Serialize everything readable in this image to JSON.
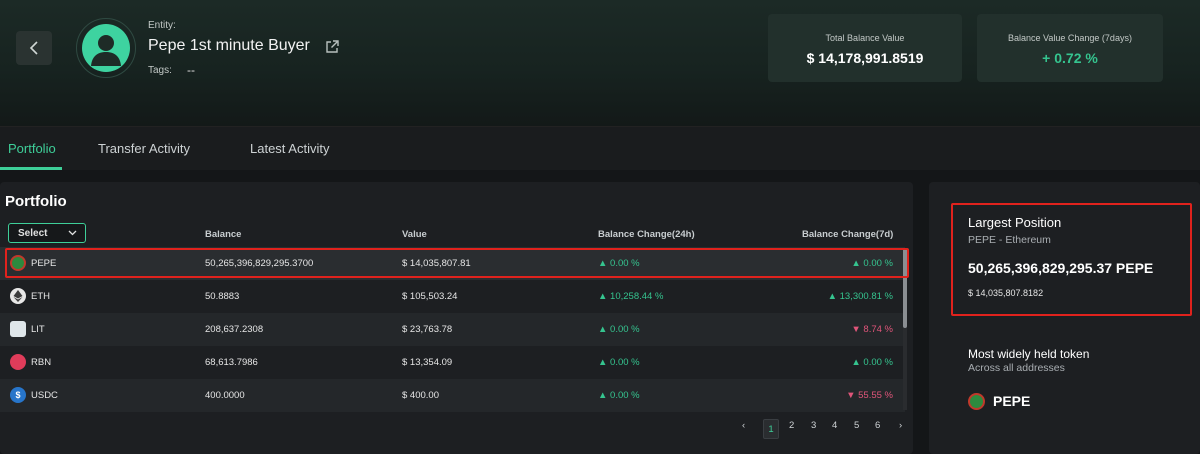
{
  "entity": {
    "label": "Entity:",
    "name": "Pepe 1st minute Buyer",
    "tags_label": "Tags:",
    "tags_value": "--"
  },
  "stats": {
    "total_balance_label": "Total Balance Value",
    "total_balance_value": "$ 14,178,991.8519",
    "change_label": "Balance Value Change (7days)",
    "change_value": "+ 0.72 %"
  },
  "tabs": [
    {
      "label": "Portfolio",
      "active": true
    },
    {
      "label": "Transfer Activity",
      "active": false
    },
    {
      "label": "Latest Activity",
      "active": false
    }
  ],
  "portfolio": {
    "title": "Portfolio",
    "select_label": "Select",
    "columns": [
      "Balance",
      "Value",
      "Balance Change(24h)",
      "Balance Change(7d)"
    ],
    "rows": [
      {
        "token": "PEPE",
        "balance": "50,265,396,829,295.3700",
        "value": "$ 14,035,807.81",
        "change24": "0.00 %",
        "change24_dir": "up",
        "change7": "0.00 %",
        "change7_dir": "up"
      },
      {
        "token": "ETH",
        "balance": "50.8883",
        "value": "$ 105,503.24",
        "change24": "10,258.44 %",
        "change24_dir": "up",
        "change7": "13,300.81 %",
        "change7_dir": "up"
      },
      {
        "token": "LIT",
        "balance": "208,637.2308",
        "value": "$ 23,763.78",
        "change24": "0.00 %",
        "change24_dir": "up",
        "change7": "8.74 %",
        "change7_dir": "down"
      },
      {
        "token": "RBN",
        "balance": "68,613.7986",
        "value": "$ 13,354.09",
        "change24": "0.00 %",
        "change24_dir": "up",
        "change7": "0.00 %",
        "change7_dir": "up"
      },
      {
        "token": "USDC",
        "balance": "400.0000",
        "value": "$ 400.00",
        "change24": "0.00 %",
        "change24_dir": "up",
        "change7": "55.55 %",
        "change7_dir": "down"
      }
    ],
    "pages": [
      "1",
      "2",
      "3",
      "4",
      "5",
      "6"
    ],
    "current_page": "1"
  },
  "largest_position": {
    "title": "Largest Position",
    "subtitle": "PEPE - Ethereum",
    "amount": "50,265,396,829,295.37 PEPE",
    "value": "$ 14,035,807.8182"
  },
  "most_held": {
    "title": "Most widely held token",
    "subtitle": "Across all addresses",
    "token": "PEPE"
  },
  "colors": {
    "accent": "#3ecf99",
    "up": "#35c48f",
    "down": "#e0557a",
    "highlight_box": "#e0221d"
  }
}
